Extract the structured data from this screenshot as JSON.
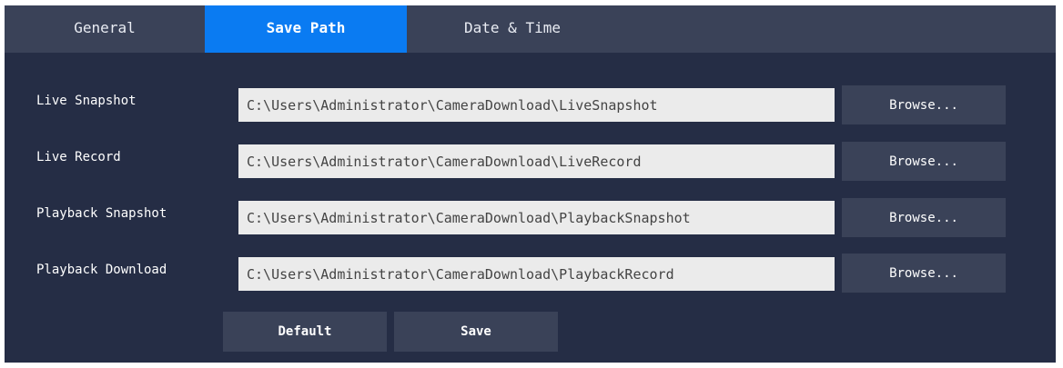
{
  "tabs": [
    {
      "label": "General",
      "active": false
    },
    {
      "label": "Save Path",
      "active": true
    },
    {
      "label": "Date & Time",
      "active": false
    }
  ],
  "rows": [
    {
      "label": "Live Snapshot",
      "path": "C:\\Users\\Administrator\\CameraDownload\\LiveSnapshot",
      "button": "Browse..."
    },
    {
      "label": "Live Record",
      "path": "C:\\Users\\Administrator\\CameraDownload\\LiveRecord",
      "button": "Browse..."
    },
    {
      "label": "Playback Snapshot",
      "path": "C:\\Users\\Administrator\\CameraDownload\\PlaybackSnapshot",
      "button": "Browse..."
    },
    {
      "label": "Playback Download",
      "path": "C:\\Users\\Administrator\\CameraDownload\\PlaybackRecord",
      "button": "Browse..."
    }
  ],
  "actions": {
    "default_label": "Default",
    "save_label": "Save"
  },
  "colors": {
    "background": "#252d45",
    "tabbar": "#3a4258",
    "active_tab": "#0a7bf2",
    "field": "#ebebeb",
    "button": "#3a4258"
  }
}
